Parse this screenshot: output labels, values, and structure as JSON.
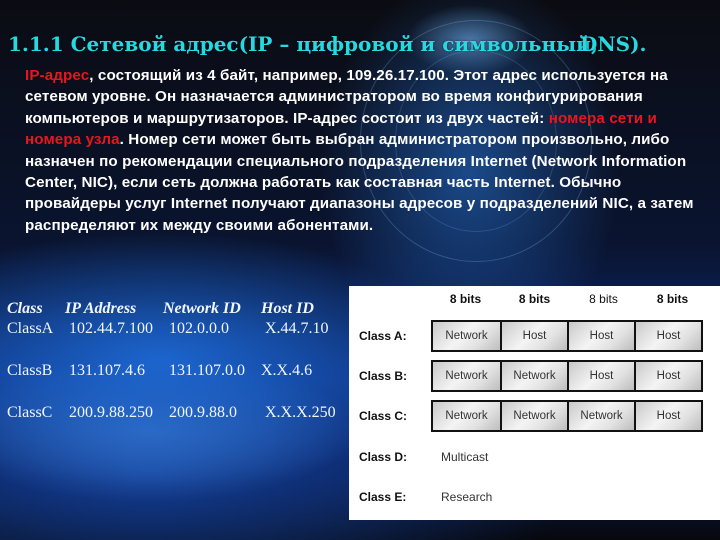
{
  "slide": {
    "title_main": "1.1.1 Сетевой адрес(IP – цифровой и символьный,",
    "title_overlap": "DNS).",
    "paragraph": [
      {
        "text": "IP-адрес",
        "red": true
      },
      {
        "text": ", состоящий из 4 байт, например, 109.26.17.100. Этот адрес используется на сетевом уровне. Он назначается администратором во время конфигурирования компьютеров и маршрутизаторов. IP-адрес состоит из двух частей: ",
        "red": false
      },
      {
        "text": "номера сети и номера узла",
        "red": true
      },
      {
        "text": ". Номер сети может быть выбран администратором произвольно, либо назначен по рекомендации специального подразделения Internet (Network Information Center, NIC), если сеть должна работать как составная часть Internet. Обычно провайдеры услуг Internet получают диапазоны адресов у подразделений NIC, а затем распределяют их между своими абонентами.",
        "red": false
      }
    ],
    "colors": {
      "title": "#26d8e0",
      "highlight": "#e8161e",
      "text": "#ffffff"
    }
  },
  "class_examples": {
    "headers": [
      "Class",
      "IP Address",
      "Network ID",
      "Host ID"
    ],
    "rows": [
      [
        "ClassA",
        "102.44.7.100",
        "102.0.0.0",
        "X.44.7.10"
      ],
      [
        "ClassB",
        "131.107.4.6",
        "131.107.0.0",
        "X.X.4.6"
      ],
      [
        "ClassC",
        "200.9.88.250",
        "200.9.88.0",
        "X.X.X.250"
      ]
    ]
  },
  "octet_diagram": {
    "bits_headers": [
      "8 bits",
      "8 bits",
      "8 bits",
      "8 bits"
    ],
    "classes": [
      {
        "label": "Class A:",
        "cells": [
          "Network",
          "Host",
          "Host",
          "Host"
        ]
      },
      {
        "label": "Class B:",
        "cells": [
          "Network",
          "Network",
          "Host",
          "Host"
        ]
      },
      {
        "label": "Class C:",
        "cells": [
          "Network",
          "Network",
          "Network",
          "Host"
        ]
      },
      {
        "label": "Class D:",
        "text": "Multicast"
      },
      {
        "label": "Class E:",
        "text": "Research"
      }
    ]
  }
}
